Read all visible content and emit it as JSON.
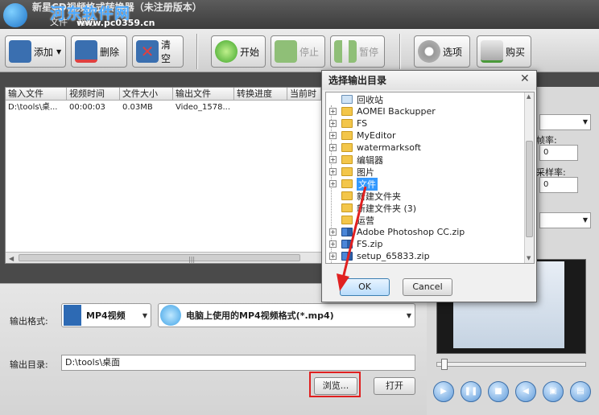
{
  "window": {
    "title": "新星CD视频格式转换器（未注册版本）",
    "menu": [
      "文件",
      "帮助"
    ]
  },
  "watermark": {
    "text": "河东软件网",
    "url": "www.pc0359.cn"
  },
  "toolbar": {
    "add": "添加",
    "delete": "删除",
    "clear": "清空",
    "start": "开始",
    "stop": "停止",
    "pause": "暂停",
    "options": "选项",
    "buy": "购买"
  },
  "filelist": {
    "columns": [
      "输入文件",
      "视频时间",
      "文件大小",
      "输出文件",
      "转换进度",
      "当前时"
    ],
    "rows": [
      {
        "input": "D:\\tools\\桌...",
        "duration": "00:00:03",
        "size": "0.03MB",
        "output": "Video_1578...",
        "progress": "",
        "current": ""
      }
    ]
  },
  "output": {
    "format_label": "输出格式:",
    "format_value": "MP4视频",
    "format_desc": "电脑上使用的MP4视频格式(*.mp4)",
    "dir_label": "输出目录:",
    "dir_value": "D:\\tools\\桌面",
    "browse": "浏览...",
    "open": "打开"
  },
  "right_panel": {
    "frame_rate_label": "帧率:",
    "frame_rate_value": "0",
    "sample_rate_label": "采样率:",
    "sample_rate_value": "0"
  },
  "dialog": {
    "title": "选择输出目录",
    "ok": "OK",
    "cancel": "Cancel",
    "tree": [
      {
        "label": "回收站",
        "expand": false,
        "kind": "bin"
      },
      {
        "label": "AOMEI Backupper",
        "expand": true,
        "kind": "folder"
      },
      {
        "label": "FS",
        "expand": true,
        "kind": "folder"
      },
      {
        "label": "MyEditor",
        "expand": true,
        "kind": "folder"
      },
      {
        "label": "watermarksoft",
        "expand": true,
        "kind": "folder"
      },
      {
        "label": "编辑器",
        "expand": true,
        "kind": "folder"
      },
      {
        "label": "图片",
        "expand": true,
        "kind": "folder"
      },
      {
        "label": "文件",
        "expand": true,
        "kind": "folder",
        "selected": true
      },
      {
        "label": "新建文件夹",
        "expand": false,
        "kind": "folder"
      },
      {
        "label": "新建文件夹 (3)",
        "expand": false,
        "kind": "folder"
      },
      {
        "label": "运营",
        "expand": false,
        "kind": "folder"
      },
      {
        "label": "Adobe Photoshop CC.zip",
        "expand": true,
        "kind": "zip"
      },
      {
        "label": "FS.zip",
        "expand": true,
        "kind": "zip"
      },
      {
        "label": "setup_65833.zip",
        "expand": true,
        "kind": "zip"
      }
    ]
  },
  "colors": {
    "accent": "#3399ff",
    "highlight": "#e02020"
  }
}
